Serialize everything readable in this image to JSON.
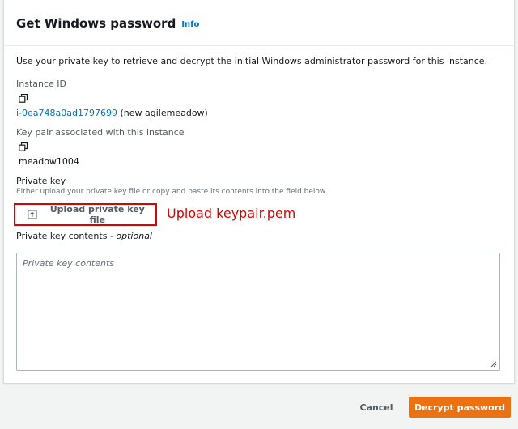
{
  "dialog": {
    "title": "Get Windows password",
    "info_label": "Info",
    "description": "Use your private key to retrieve and decrypt the initial Windows administrator password for this instance."
  },
  "instance": {
    "label": "Instance ID",
    "id": "i-0ea748a0ad1797699",
    "name_suffix": " (new agilemeadow)"
  },
  "key_pair": {
    "label": "Key pair associated with this instance",
    "value": "meadow1004"
  },
  "private_key": {
    "label": "Private key",
    "hint": "Either upload your private key file or copy and paste its contents into the field below.",
    "upload_label": "Upload private key file",
    "annotation": "Upload keypair.pem",
    "contents_label": "Private key contents - ",
    "contents_optional": "optional",
    "contents_placeholder": "Private key contents"
  },
  "footer": {
    "cancel_label": "Cancel",
    "decrypt_label": "Decrypt password"
  },
  "colors": {
    "accent": "#ec7211",
    "link": "#0073bb",
    "annotation": "#e00000"
  },
  "icons": {
    "copy": "copy-icon",
    "upload": "upload-icon",
    "resize": "resize-grip-icon"
  }
}
